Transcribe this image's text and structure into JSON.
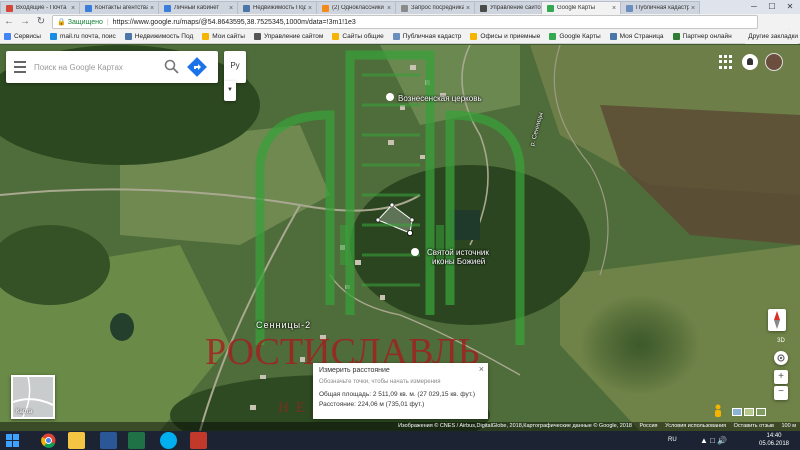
{
  "browser": {
    "tabs": [
      {
        "title": "Входящие - Почта",
        "favicon_color": "#d44638",
        "active": false
      },
      {
        "title": "Контакты агентства",
        "favicon_color": "#3b7ddd",
        "active": false
      },
      {
        "title": "Личный кабинет",
        "favicon_color": "#3b7ddd",
        "active": false
      },
      {
        "title": "Недвижимость Подольск",
        "favicon_color": "#4a76a8",
        "active": false
      },
      {
        "title": "(2) Одноклассники",
        "favicon_color": "#f28b1a",
        "active": false
      },
      {
        "title": "Запрос посредника",
        "favicon_color": "#8a8a8a",
        "active": false
      },
      {
        "title": "Управление сайтом",
        "favicon_color": "#4a4a4a",
        "active": false
      },
      {
        "title": "Google Карты",
        "favicon_color": "#34a853",
        "active": true
      },
      {
        "title": "Публичная кадастровая",
        "favicon_color": "#6a8fbf",
        "active": false
      }
    ],
    "tab_close_glyph": "×",
    "window_controls": [
      "─",
      "☐",
      "✕"
    ],
    "security_label": "Защищено",
    "url": "https://www.google.ru/maps/@54.8643595,38.7525345,1000m/data=!3m1!1e3",
    "bookmarks": [
      {
        "label": "Сервисы",
        "color": "#4285f4"
      },
      {
        "label": "mail.ru почта, поис",
        "color": "#168de2"
      },
      {
        "label": "Недвижимость Под",
        "color": "#4a76a8"
      },
      {
        "label": "Мои сайты",
        "color": "#f4b400"
      },
      {
        "label": "Управление сайтом",
        "color": "#555555"
      },
      {
        "label": "Сайты общие",
        "color": "#f4b400"
      },
      {
        "label": "Публичная кадастр",
        "color": "#6a8fbf"
      },
      {
        "label": "Офисы и приемные",
        "color": "#f4b400"
      },
      {
        "label": "Google Карты",
        "color": "#34a853"
      },
      {
        "label": "Моя Страница",
        "color": "#4a76a8"
      },
      {
        "label": "Партнер онлайн",
        "color": "#2e7d32"
      }
    ],
    "bookmarks_more": "Другие закладки"
  },
  "map": {
    "search_placeholder": "Поиск на Google Картах",
    "language_button": "Ру",
    "labels": {
      "church": "Вознесенская церковь",
      "spring_line1": "Святой источник",
      "spring_line2": "иконы Божией",
      "village": "Сенницы-2",
      "street": "р. Сенницы"
    },
    "measure": {
      "title": "Измерить расстояние",
      "hint": "Обозначьте точки, чтобы начать измерения",
      "area": "Общая площадь: 2 511,09 кв. м. (27 029,15 кв. фут.)",
      "distance": "Расстояние: 224,06 м (735,01 фут.)",
      "close_glyph": "×"
    },
    "minimap_label": "Карта",
    "btn_3d": "3D",
    "zoom_in": "+",
    "zoom_out": "−",
    "attribution": [
      "Изображения © CNES / Airbus,DigitalGlobe, 2018,Картографические данные © Google, 2018",
      "Россия",
      "Условия использования",
      "Оставить отзыв",
      "100 м"
    ]
  },
  "watermark": {
    "text": "РОСТИСЛАВЛЬ",
    "subtext": "НЕДВИЖИМОСТЬ",
    "color": "#a32020"
  },
  "taskbar": {
    "language": "RU",
    "time": "14:40",
    "date": "05.06.2018"
  }
}
